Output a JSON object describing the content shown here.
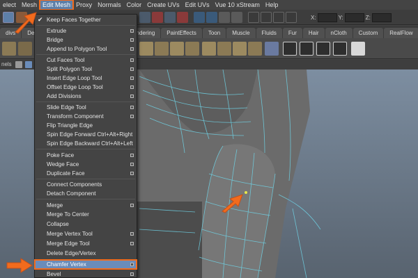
{
  "menubar": {
    "items": [
      "elect",
      "Mesh",
      "Edit Mesh",
      "Proxy",
      "Normals",
      "Color",
      "Create UVs",
      "Edit UVs",
      "Vue 10 xStream",
      "Help"
    ],
    "active_index": 2
  },
  "statusline": {
    "x_label": "X:",
    "y_label": "Y:",
    "z_label": "Z:"
  },
  "shelf": {
    "tabs": [
      "divs",
      "Defo",
      "endering",
      "PaintEffects",
      "Toon",
      "Muscle",
      "Fluids",
      "Fur",
      "Hair",
      "nCloth",
      "Custom",
      "RealFlow"
    ]
  },
  "panelbar": {
    "label": "nels"
  },
  "edit_mesh_menu": {
    "items": [
      {
        "label": "Keep Faces Together",
        "checked": true,
        "option": false
      },
      {
        "label": "Extrude",
        "option": true
      },
      {
        "label": "Bridge",
        "option": true
      },
      {
        "label": "Append to Polygon Tool",
        "option": true
      },
      {
        "label": "Cut Faces Tool",
        "option": true
      },
      {
        "label": "Split Polygon Tool",
        "option": true
      },
      {
        "label": "Insert Edge Loop Tool",
        "option": true
      },
      {
        "label": "Offset Edge Loop Tool",
        "option": true
      },
      {
        "label": "Add Divisions",
        "option": true
      },
      {
        "label": "Slide Edge Tool",
        "option": true
      },
      {
        "label": "Transform Component",
        "option": true
      },
      {
        "label": "Flip Triangle Edge",
        "option": false
      },
      {
        "label": "Spin Edge Forward  Ctrl+Alt+Right",
        "option": false
      },
      {
        "label": "Spin Edge Backward  Ctrl+Alt+Left",
        "option": false
      },
      {
        "label": "Poke Face",
        "option": true
      },
      {
        "label": "Wedge Face",
        "option": true
      },
      {
        "label": "Duplicate Face",
        "option": true
      },
      {
        "label": "Connect Components",
        "option": false
      },
      {
        "label": "Detach Component",
        "option": false
      },
      {
        "label": "Merge",
        "option": true
      },
      {
        "label": "Merge To Center",
        "option": false
      },
      {
        "label": "Collapse",
        "option": false
      },
      {
        "label": "Merge Vertex Tool",
        "option": true
      },
      {
        "label": "Merge Edge Tool",
        "option": true
      },
      {
        "label": "Delete Edge/Vertex",
        "option": false
      },
      {
        "label": "Chamfer Vertex",
        "option": true,
        "highlighted": true
      },
      {
        "label": "Bevel",
        "option": true
      }
    ]
  },
  "colors": {
    "highlight_outline": "#f26b1d",
    "menu_highlight": "#6a8cba",
    "wire": "#6fd3e6",
    "mesh": "#6e6e6e"
  }
}
